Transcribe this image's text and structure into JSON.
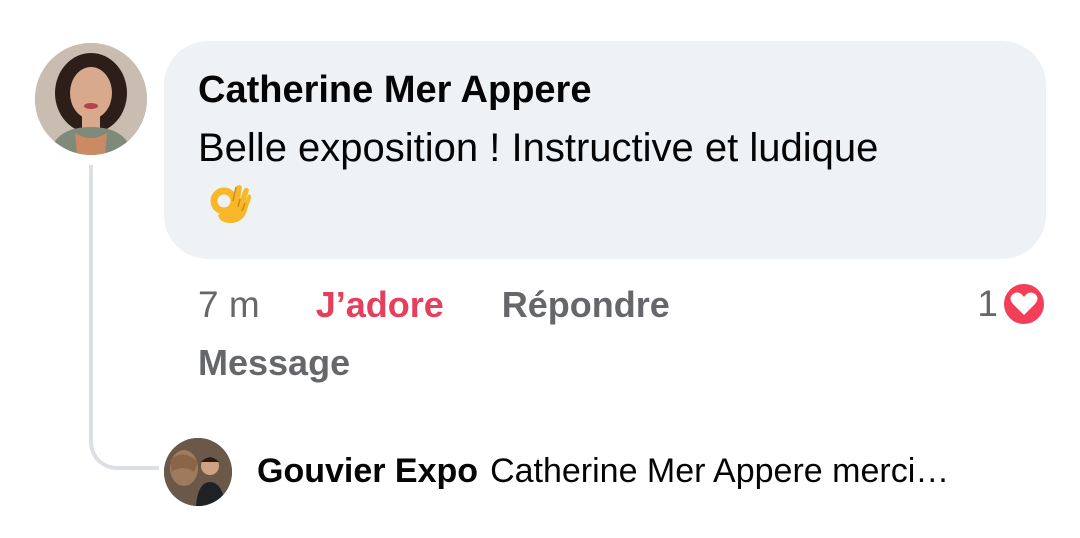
{
  "comment": {
    "author": "Catherine Mer Appere",
    "text": "Belle exposition ! Instructive et ludique",
    "emoji_icon": "ok-hand-emoji",
    "timestamp": "7 m",
    "like_label": "J’adore",
    "reply_label": "Répondre",
    "message_label": "Message",
    "reaction_count": "1",
    "reaction_icon": "heart-reaction-icon"
  },
  "reply": {
    "author": "Gouvier Expo",
    "preview": "Catherine Mer Appere merci…"
  },
  "colors": {
    "bubble_bg": "#eff2f5",
    "like_active": "#e53f5c",
    "secondary_text": "#65676b",
    "thread_line": "#dcdfe3",
    "heart": "#f33e58"
  }
}
